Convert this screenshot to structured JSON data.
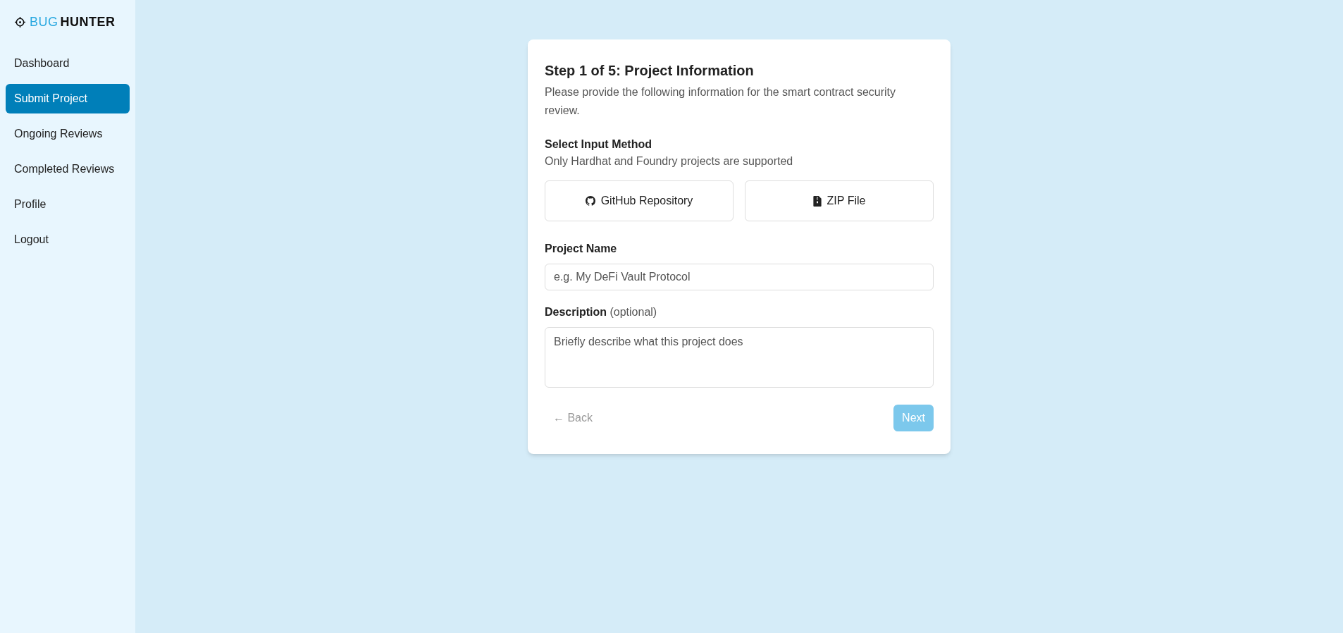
{
  "sidebar": {
    "logo": [
      "BUG",
      "HUNTER"
    ],
    "items": [
      {
        "label": "Dashboard",
        "selected": false
      },
      {
        "label": "Submit Project",
        "selected": true
      },
      {
        "label": "Ongoing Reviews",
        "selected": false
      },
      {
        "label": "Completed Reviews",
        "selected": false
      },
      {
        "label": "Profile",
        "selected": false
      },
      {
        "label": "Logout",
        "selected": false
      }
    ]
  },
  "form": {
    "title": "Step 1 of 5: Project Information",
    "subtitle": "Please provide the following information for the smart contract security review.",
    "input_method": {
      "label": "Select Input Method",
      "hint": "Only Hardhat and Foundry projects are supported",
      "options": [
        {
          "kind": "github",
          "label": "GitHub Repository",
          "selected": false
        },
        {
          "kind": "zip",
          "label": "ZIP File",
          "selected": false
        }
      ]
    },
    "project_name": {
      "label": "Project Name",
      "placeholder": "e.g. My DeFi Vault Protocol"
    },
    "description": {
      "label": "**Description** (optional)",
      "placeholder": "Briefly describe what this project does"
    },
    "back": {
      "label": "← Back",
      "disabled": true
    },
    "next": {
      "label": "Next",
      "disabled": true
    }
  }
}
